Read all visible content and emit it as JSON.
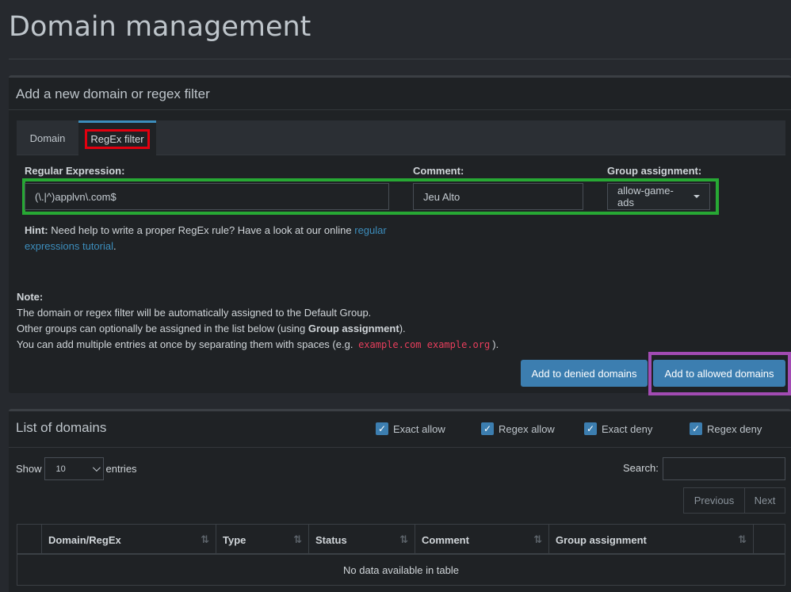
{
  "page": {
    "title": "Domain management"
  },
  "add_box": {
    "title": "Add a new domain or regex filter",
    "tabs": [
      {
        "label": "Domain",
        "active": false
      },
      {
        "label": "RegEx filter",
        "active": true
      }
    ],
    "regex_label": "Regular Expression:",
    "regex_value": "(\\.|^)applvn\\.com$",
    "comment_label": "Comment:",
    "comment_value": "Jeu Alto",
    "group_label": "Group assignment:",
    "group_value": "allow-game-ads",
    "hint_bold": "Hint:",
    "hint_text": " Need help to write a proper RegEx rule? Have a look at our online ",
    "hint_link": "regular expressions tutorial",
    "hint_end": ".",
    "note_title": "Note:",
    "note_line1": "The domain or regex filter will be automatically assigned to the Default Group.",
    "note_line2_a": "Other groups can optionally be assigned in the list below (using ",
    "note_line2_b": "Group assignment",
    "note_line2_c": ").",
    "note_line3_a": "You can add multiple entries at once by separating them with spaces (e.g. ",
    "note_code": "example.com example.org",
    "note_line3_c": ").",
    "btn_deny": "Add to denied domains",
    "btn_allow": "Add to allowed domains"
  },
  "list_box": {
    "title": "List of domains",
    "filters": [
      {
        "label": "Exact allow",
        "checked": true
      },
      {
        "label": "Regex allow",
        "checked": true
      },
      {
        "label": "Exact deny",
        "checked": true
      },
      {
        "label": "Regex deny",
        "checked": true
      }
    ],
    "show_label": "Show",
    "entries_value": "10",
    "entries_label": "entries",
    "search_label": "Search:",
    "prev_label": "Previous",
    "next_label": "Next",
    "columns": [
      "Domain/RegEx",
      "Type",
      "Status",
      "Comment",
      "Group assignment"
    ],
    "empty_text": "No data available in table"
  },
  "colors": {
    "accent": "#3c7eb0",
    "highlight_red": "#e3000f",
    "highlight_green": "#27a834",
    "highlight_purple": "#a24bb3"
  }
}
